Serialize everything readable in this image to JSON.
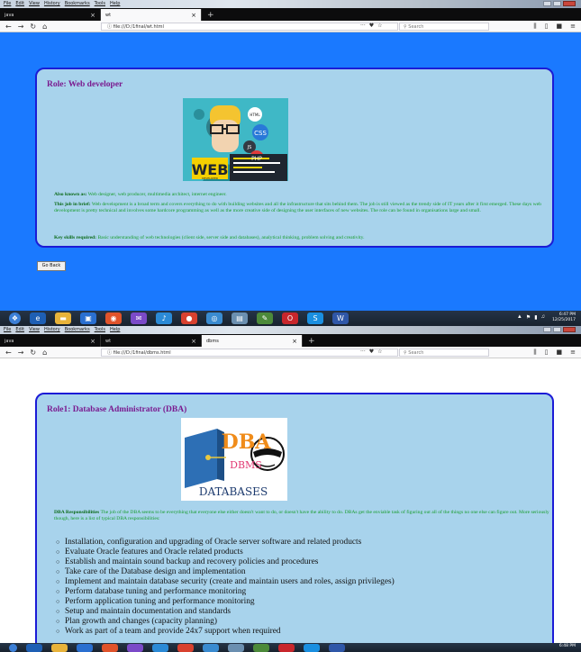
{
  "browser_menu": [
    "File",
    "Edit",
    "View",
    "History",
    "Bookmarks",
    "Tools",
    "Help"
  ],
  "screen1": {
    "tabs": [
      {
        "label": "java"
      },
      {
        "label": "wt"
      }
    ],
    "url": "file:///D:/1final/wt.html",
    "search_placeholder": "Search",
    "role_title": "Role: Web developer",
    "image_text": {
      "web": "WEB",
      "developer": "DEVELOPER",
      "html": "HTML",
      "css": "CSS",
      "js": "JS",
      "php": "PHP"
    },
    "also_known_as_label": "Also known as:",
    "also_known_as_text": " Web designer, web producer, multimedia architect, internet engineer.",
    "job_brief_label": "This job in brief:",
    "job_brief_text": " Web development is a broad term and covers everything to do with building websites and all the infrastructure that sits behind them. The job is still viewed as the trendy side of IT years after it first emerged. These days web development is pretty technical and involves some hardcore programming as well as the more creative side of designing the user interfaces of new websites. The role can be found in organisations large and small.",
    "key_skills_label": "Key skills required:",
    "key_skills_text": " Basic understanding of web technologies (client side, server side and databases), analytical thinking, problem solving and creativity.",
    "back_button": "Go Back",
    "clock": {
      "time": "6:47 PM",
      "date": "12/25/2017"
    }
  },
  "screen2": {
    "tabs": [
      {
        "label": "java"
      },
      {
        "label": "wt"
      },
      {
        "label": "dbms"
      }
    ],
    "url": "file:///D:/1final/dbms.html",
    "search_placeholder": "Search",
    "role_title": "Role1: Database Administrator (DBA)",
    "image_text": {
      "dba": "DBA",
      "dbms": "DBMS",
      "databases": "DATABASES"
    },
    "resp_label": "DBA Responsibilities",
    "resp_text": " The job of the DBA seems to be everything that everyone else either doesn't want to do, or doesn't have the ability to do. DBAs get the enviable task of figuring out all of the things no one else can figure out. More seriously though, here is a list of typical DBA responsibilities:",
    "duties": [
      "Installation, configuration and upgrading of Oracle server software and related products",
      "Evaluate Oracle features and Oracle related products",
      "Establish and maintain sound backup and recovery policies and procedures",
      "Take care of the Database design and implementation",
      "Implement and maintain database security (create and maintain users and roles, assign privileges)",
      "Perform database tuning and performance monitoring",
      "Perform application tuning and performance monitoring",
      "Setup and maintain documentation and standards",
      "Plan growth and changes (capacity planning)",
      "Work as part of a team and provide 24x7 support when required"
    ],
    "clock": {
      "time": "6:48 PM"
    }
  },
  "colors": {
    "page_bg": "#1a79ff",
    "card_bg": "#a8d3ec",
    "card_border": "#1b1bd6",
    "title": "#7a1a8f",
    "body_text": "#169c2b"
  }
}
